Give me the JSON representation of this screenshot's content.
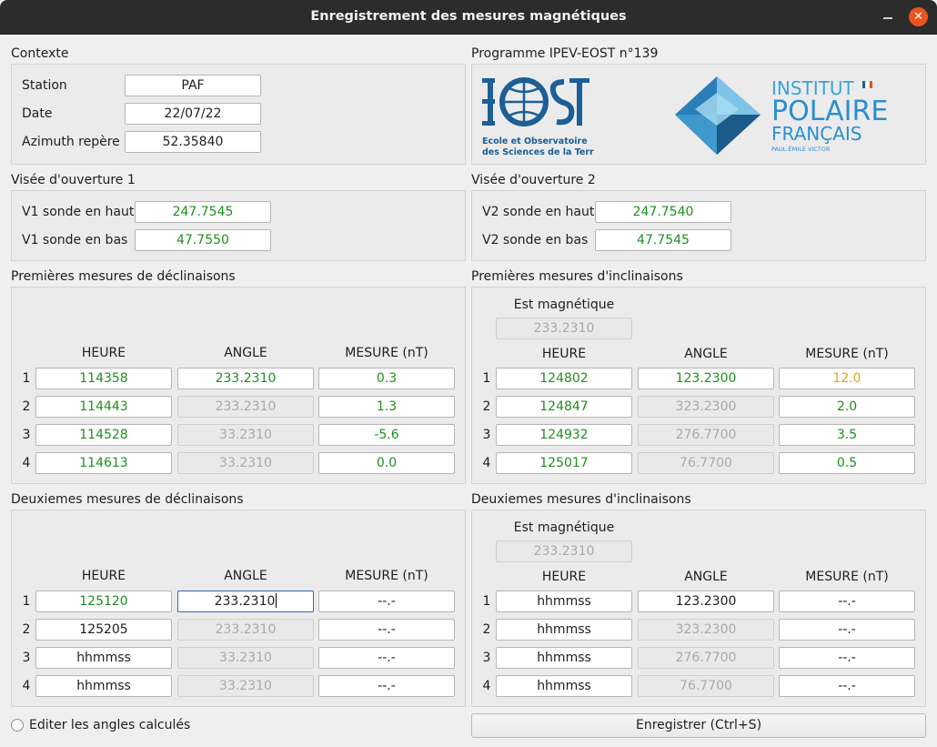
{
  "window": {
    "title": "Enregistrement des mesures magnétiques"
  },
  "contexte": {
    "title": "Contexte",
    "station_label": "Station",
    "station_value": "PAF",
    "date_label": "Date",
    "date_value": "22/07/22",
    "azimuth_label": "Azimuth repère",
    "azimuth_value": "52.35840"
  },
  "programme": {
    "title": "Programme IPEV-EOST n°139",
    "eost_line1": "Ecole et Observatoire",
    "eost_line2": "des Sciences de la Terre",
    "ipev_line1": "INSTITUT",
    "ipev_line2": "POLAIRE",
    "ipev_line3": "FRANÇAIS",
    "ipev_line4": "PAUL-ÉMILE VICTOR"
  },
  "visee1": {
    "title": "Visée d'ouverture 1",
    "haut_label": "V1 sonde en haut",
    "haut_value": "247.7545",
    "bas_label": "V1 sonde en bas",
    "bas_value": "47.7550"
  },
  "visee2": {
    "title": "Visée d'ouverture 2",
    "haut_label": "V2 sonde en haut",
    "haut_value": "247.7540",
    "bas_label": "V2 sonde en bas",
    "bas_value": "47.7545"
  },
  "columns": {
    "heure": "HEURE",
    "angle": "ANGLE",
    "mesure": "MESURE (nT)"
  },
  "decl1": {
    "title": "Premières mesures de déclinaisons",
    "rows": [
      {
        "n": "1",
        "heure": "114358",
        "angle": "233.2310",
        "mesure": "0.3"
      },
      {
        "n": "2",
        "heure": "114443",
        "angle": "233.2310",
        "mesure": "1.3"
      },
      {
        "n": "3",
        "heure": "114528",
        "angle": "33.2310",
        "mesure": "-5.6"
      },
      {
        "n": "4",
        "heure": "114613",
        "angle": "33.2310",
        "mesure": "0.0"
      }
    ]
  },
  "incl1": {
    "title": "Premières mesures d'inclinaisons",
    "est_label": "Est magnétique",
    "est_value": "233.2310",
    "rows": [
      {
        "n": "1",
        "heure": "124802",
        "angle": "123.2300",
        "mesure": "12.0"
      },
      {
        "n": "2",
        "heure": "124847",
        "angle": "323.2300",
        "mesure": "2.0"
      },
      {
        "n": "3",
        "heure": "124932",
        "angle": "276.7700",
        "mesure": "3.5"
      },
      {
        "n": "4",
        "heure": "125017",
        "angle": "76.7700",
        "mesure": "0.5"
      }
    ]
  },
  "decl2": {
    "title": "Deuxiemes mesures de déclinaisons",
    "rows": [
      {
        "n": "1",
        "heure": "125120",
        "angle": "233.2310",
        "mesure": "--.-"
      },
      {
        "n": "2",
        "heure": "125205",
        "angle": "233.2310",
        "mesure": "--.-"
      },
      {
        "n": "3",
        "heure": "hhmmss",
        "angle": "33.2310",
        "mesure": "--.-"
      },
      {
        "n": "4",
        "heure": "hhmmss",
        "angle": "33.2310",
        "mesure": "--.-"
      }
    ]
  },
  "incl2": {
    "title": "Deuxiemes mesures d'inclinaisons",
    "est_label": "Est magnétique",
    "est_value": "233.2310",
    "rows": [
      {
        "n": "1",
        "heure": "hhmmss",
        "angle": "123.2300",
        "mesure": "--.-"
      },
      {
        "n": "2",
        "heure": "hhmmss",
        "angle": "323.2300",
        "mesure": "--.-"
      },
      {
        "n": "3",
        "heure": "hhmmss",
        "angle": "276.7700",
        "mesure": "--.-"
      },
      {
        "n": "4",
        "heure": "hhmmss",
        "angle": "76.7700",
        "mesure": "--.-"
      }
    ]
  },
  "footer": {
    "edit_angles_label": "Editer les angles calculés",
    "save_button": "Enregistrer (Ctrl+S)"
  },
  "colors": {
    "valid": "#1f8f1f",
    "warning": "#e6a21a",
    "close_button": "#e9541f",
    "logo_blue": "#1c5e96"
  }
}
